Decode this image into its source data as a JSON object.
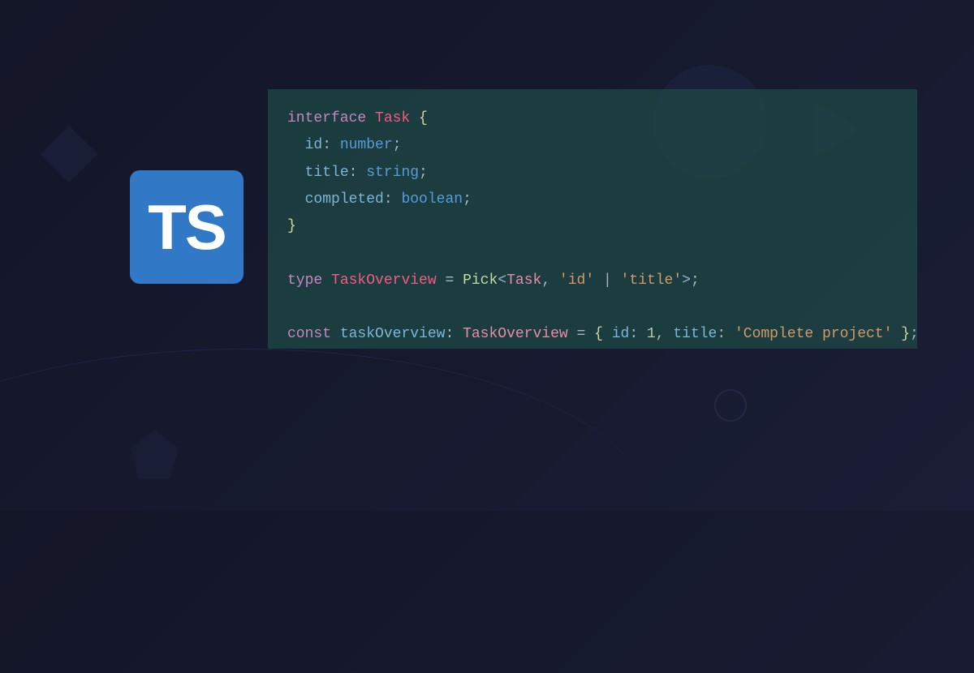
{
  "logo": {
    "text": "TS",
    "name": "typescript-logo"
  },
  "code": {
    "line1": {
      "kw": "interface",
      "name": "Task",
      "open": " {"
    },
    "line2": {
      "indent": "  ",
      "prop": "id",
      "colon": ": ",
      "type": "number",
      "semi": ";"
    },
    "line3": {
      "indent": "  ",
      "prop": "title",
      "colon": ": ",
      "type": "string",
      "semi": ";"
    },
    "line4": {
      "indent": "  ",
      "prop": "completed",
      "colon": ": ",
      "type": "boolean",
      "semi": ";"
    },
    "line5": {
      "close": "}"
    },
    "line7": {
      "kw": "type",
      "name": "TaskOverview",
      "eq": " = ",
      "util": "Pick",
      "lt": "<",
      "ref": "Task",
      "comma": ", ",
      "str1": "'id'",
      "pipe": " | ",
      "str2": "'title'",
      "gt": ">",
      "semi": ";"
    },
    "line9": {
      "kw": "const",
      "var": "taskOverview",
      "colon": ": ",
      "type": "TaskOverview",
      "eq": " = ",
      "open": "{ ",
      "prop1": "id",
      "c1": ": ",
      "num": "1",
      "comma": ", ",
      "prop2": "title",
      "c2": ": ",
      "str": "'Complete project'",
      "close": " }",
      "semi": ";"
    }
  }
}
